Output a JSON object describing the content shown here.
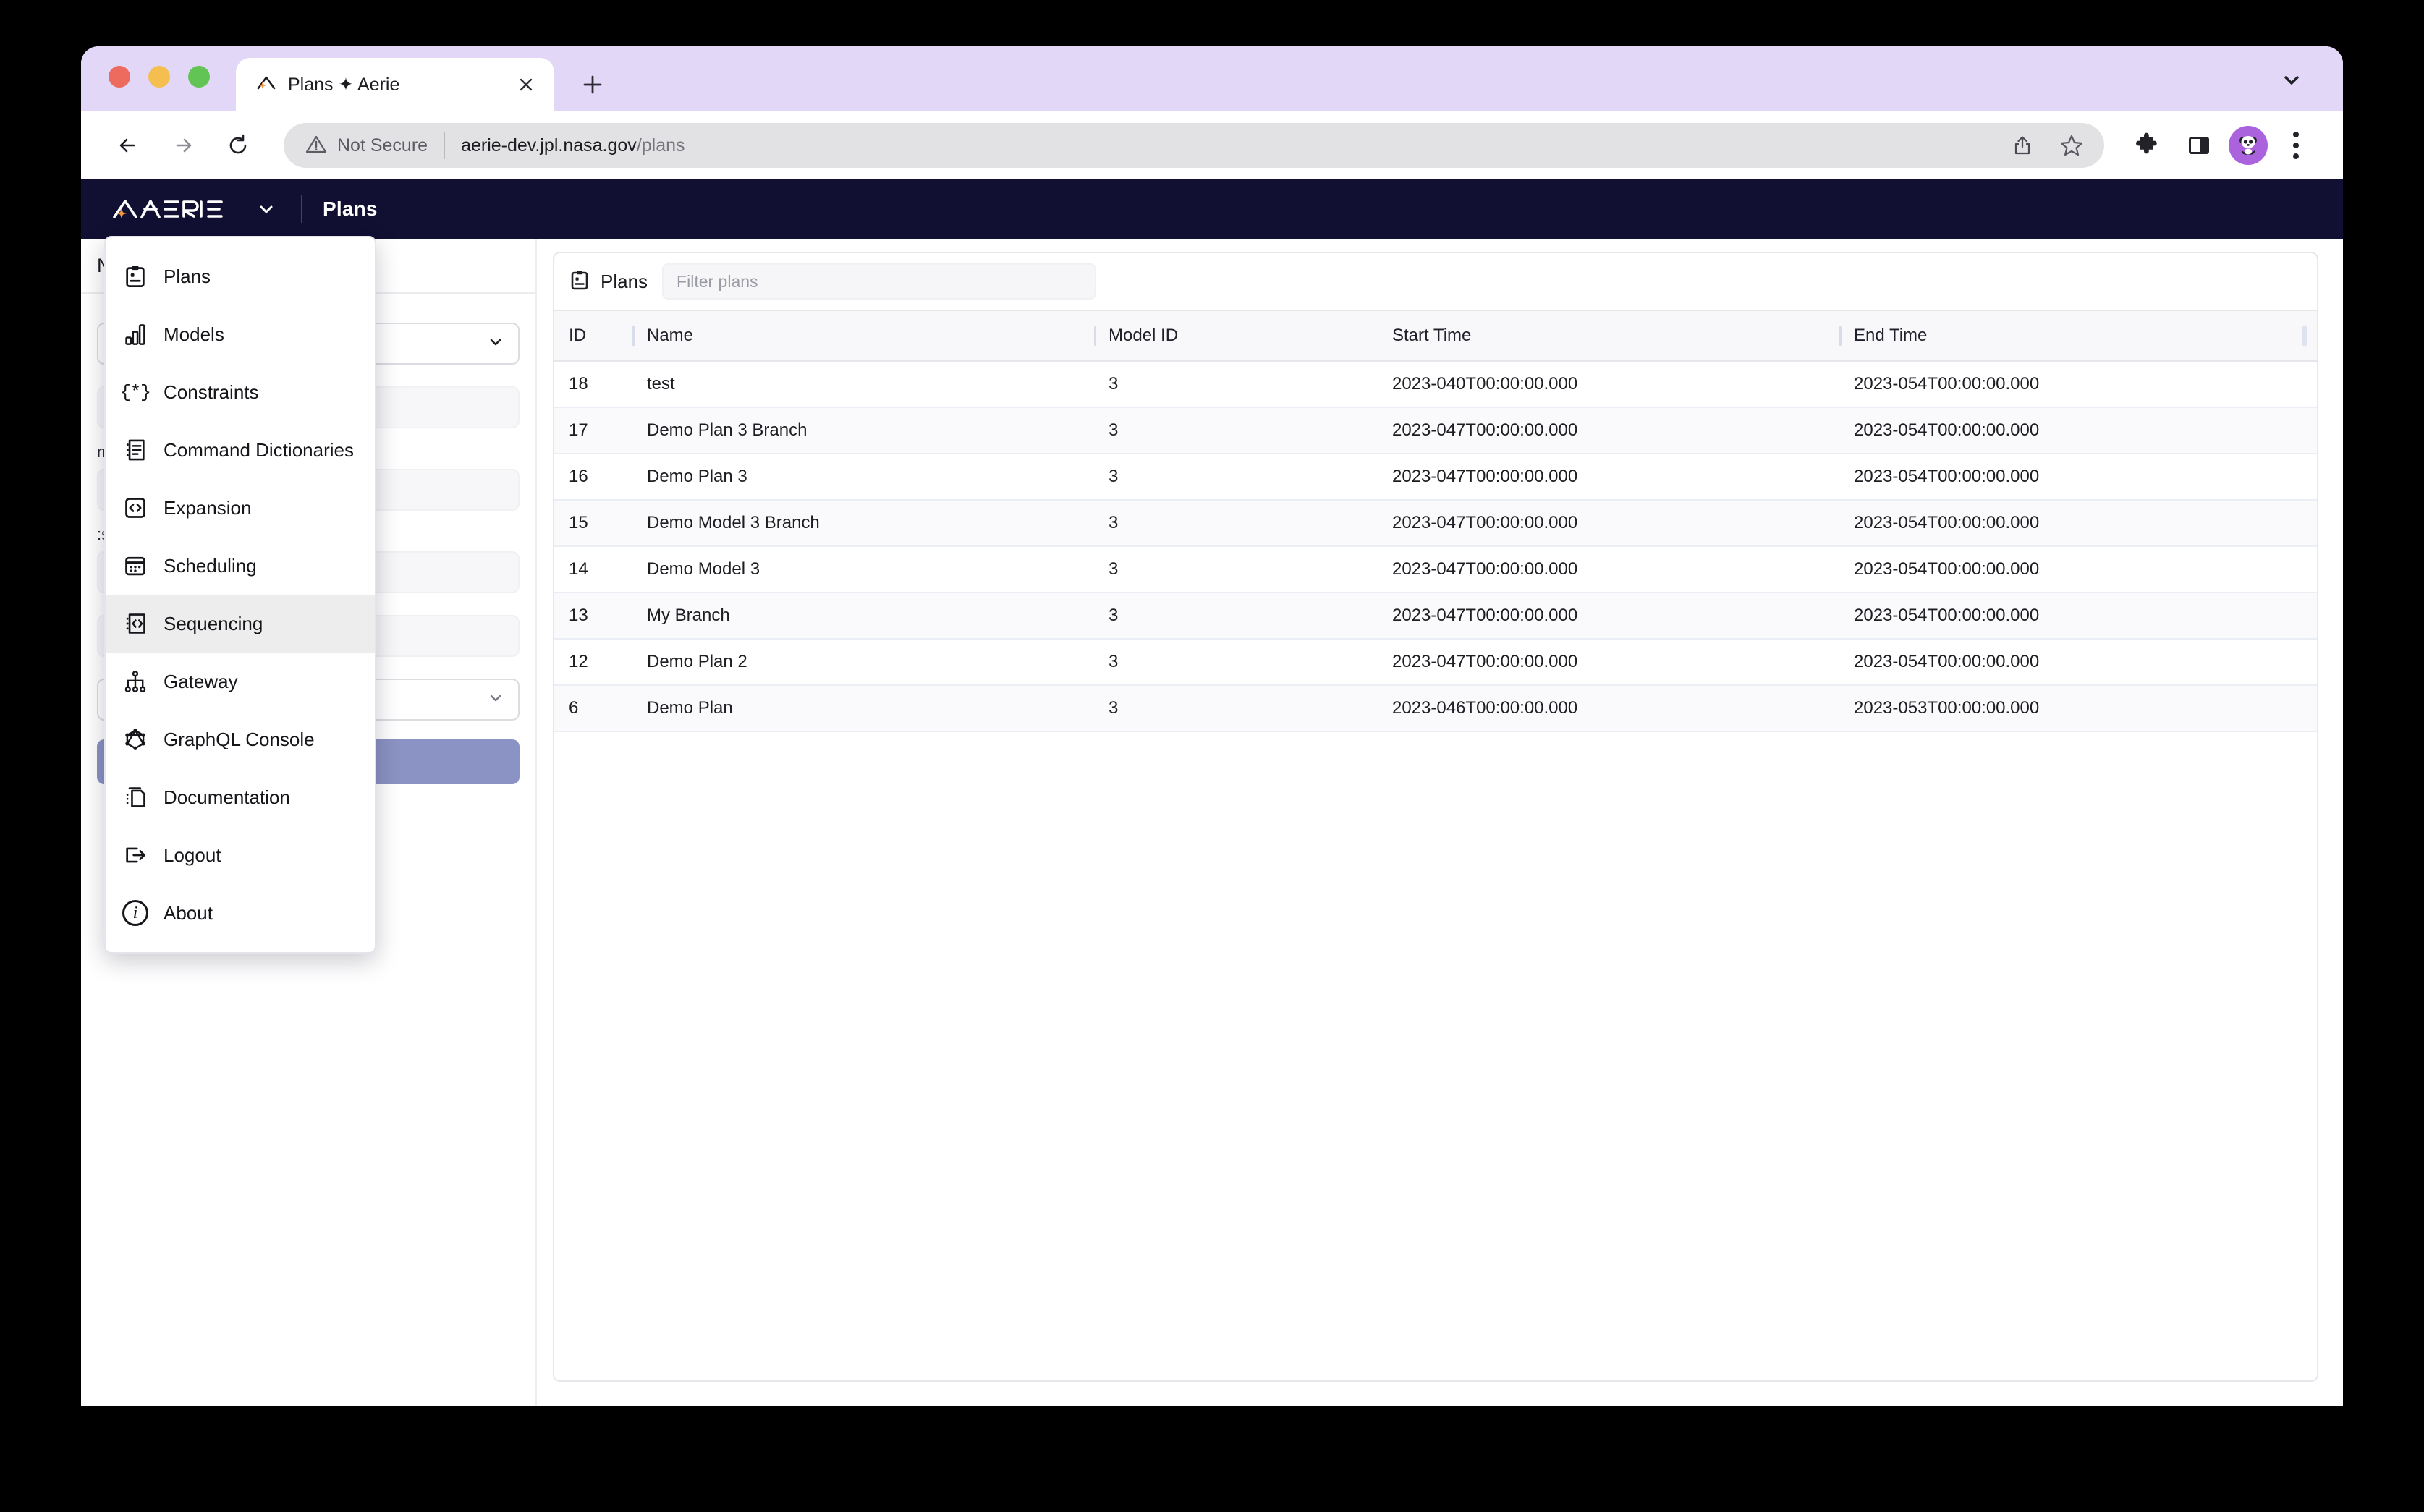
{
  "browser": {
    "tab": {
      "title": "Plans ✦ Aerie",
      "favicon_icon": "aerie-sparkle-icon",
      "close_icon": "close-icon"
    },
    "new_tab_icon": "plus-icon",
    "tab_list_chevron_icon": "chevron-down-icon",
    "nav": {
      "back_icon": "arrow-left-icon",
      "forward_icon": "arrow-right-icon",
      "reload_icon": "reload-icon"
    },
    "omnibox": {
      "security_icon": "warning-triangle-icon",
      "security_text": "Not Secure",
      "url_host": "aerie-dev.jpl.nasa.gov",
      "url_path": "/plans",
      "share_icon": "share-icon",
      "bookmark_icon": "star-icon"
    },
    "toolbar_right": {
      "extensions_icon": "puzzle-piece-icon",
      "side_panel_icon": "side-panel-icon",
      "profile_icon": "panda-avatar-icon",
      "menu_icon": "three-dot-menu-icon"
    }
  },
  "app_header": {
    "logo_text": "AERIE",
    "logo_icon": "aerie-logo-icon",
    "logo_chevron_icon": "chevron-down-icon",
    "title": "Plans"
  },
  "menu": {
    "items": [
      {
        "label": "Plans",
        "icon": "clipboard-icon",
        "active": false
      },
      {
        "label": "Models",
        "icon": "bar-chart-icon",
        "active": false
      },
      {
        "label": "Constraints",
        "icon": "braces-asterisk-icon",
        "active": false
      },
      {
        "label": "Command Dictionaries",
        "icon": "list-document-icon",
        "active": false
      },
      {
        "label": "Expansion",
        "icon": "code-brackets-icon",
        "active": false
      },
      {
        "label": "Scheduling",
        "icon": "calendar-icon",
        "active": false
      },
      {
        "label": "Sequencing",
        "icon": "sequence-code-icon",
        "active": true
      },
      {
        "label": "Gateway",
        "icon": "hierarchy-icon",
        "active": false
      },
      {
        "label": "GraphQL Console",
        "icon": "graphql-icon",
        "active": false
      },
      {
        "label": "Documentation",
        "icon": "documents-icon",
        "active": false
      },
      {
        "label": "Logout",
        "icon": "logout-icon",
        "active": false
      },
      {
        "label": "About",
        "icon": "info-circle-icon",
        "active": false
      }
    ]
  },
  "sidebar": {
    "header_title": "N",
    "fields": [
      {
        "type": "select",
        "label": "",
        "value": ""
      },
      {
        "type": "text",
        "label": "",
        "value": ""
      },
      {
        "type": "text",
        "label": "n:ss",
        "value": ""
      },
      {
        "type": "text",
        "label": ":ss",
        "value": ""
      },
      {
        "type": "text",
        "label": "",
        "value": ""
      },
      {
        "type": "select",
        "label": "",
        "value": ""
      }
    ],
    "submit_label": ""
  },
  "plans_panel": {
    "icon": "clipboard-icon",
    "title": "Plans",
    "filter_placeholder": "Filter plans",
    "columns": [
      "ID",
      "Name",
      "Model ID",
      "Start Time",
      "End Time"
    ],
    "rows": [
      {
        "id": "18",
        "name": "test",
        "model_id": "3",
        "start_time": "2023-040T00:00:00.000",
        "end_time": "2023-054T00:00:00.000"
      },
      {
        "id": "17",
        "name": "Demo Plan 3 Branch",
        "model_id": "3",
        "start_time": "2023-047T00:00:00.000",
        "end_time": "2023-054T00:00:00.000"
      },
      {
        "id": "16",
        "name": "Demo Plan 3",
        "model_id": "3",
        "start_time": "2023-047T00:00:00.000",
        "end_time": "2023-054T00:00:00.000"
      },
      {
        "id": "15",
        "name": "Demo Model 3 Branch",
        "model_id": "3",
        "start_time": "2023-047T00:00:00.000",
        "end_time": "2023-054T00:00:00.000"
      },
      {
        "id": "14",
        "name": "Demo Model 3",
        "model_id": "3",
        "start_time": "2023-047T00:00:00.000",
        "end_time": "2023-054T00:00:00.000"
      },
      {
        "id": "13",
        "name": "My Branch",
        "model_id": "3",
        "start_time": "2023-047T00:00:00.000",
        "end_time": "2023-054T00:00:00.000"
      },
      {
        "id": "12",
        "name": "Demo Plan 2",
        "model_id": "3",
        "start_time": "2023-047T00:00:00.000",
        "end_time": "2023-054T00:00:00.000"
      },
      {
        "id": "6",
        "name": "Demo Plan",
        "model_id": "3",
        "start_time": "2023-046T00:00:00.000",
        "end_time": "2023-053T00:00:00.000"
      }
    ]
  },
  "colors": {
    "header_navy": "#110f32",
    "tabstrip_lavender": "#e3d7f8",
    "accent_orange": "#f0983f",
    "primary_button": "#8b93c4",
    "avatar_purple": "#ab62dd"
  }
}
